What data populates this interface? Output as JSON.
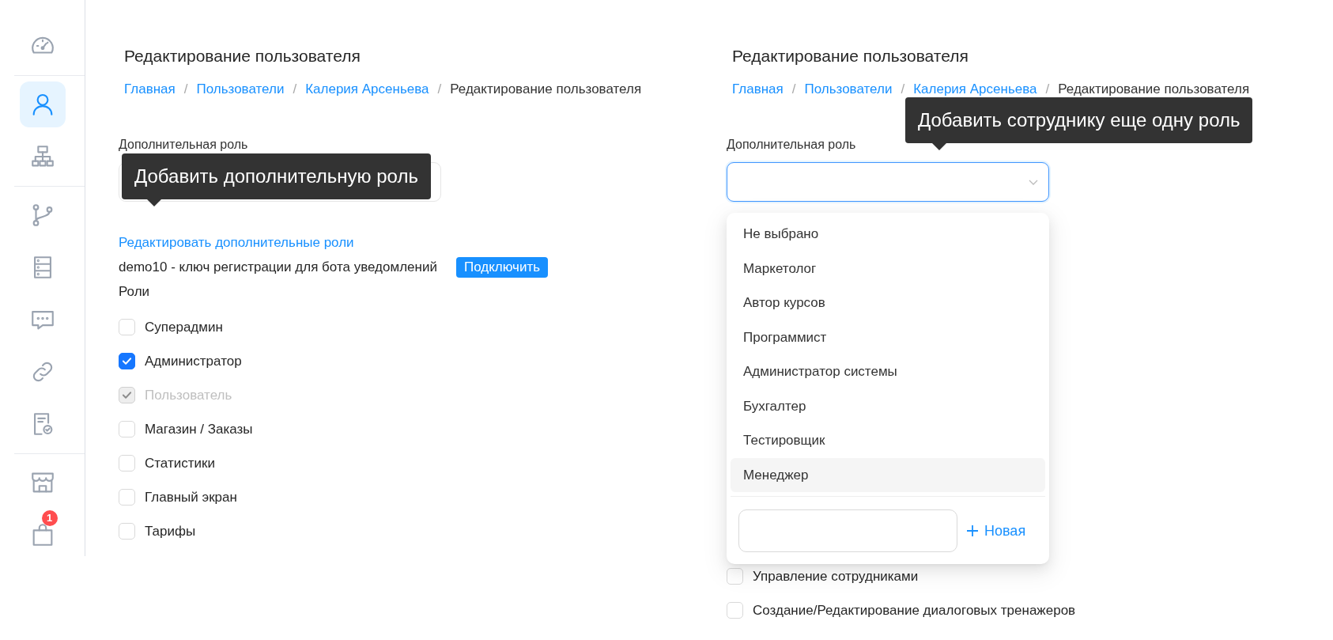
{
  "sidebar": {
    "groups": [
      {
        "items": [
          {
            "kind": "gauge",
            "selected": false
          }
        ]
      },
      {
        "items": [
          {
            "kind": "user",
            "selected": true
          },
          {
            "kind": "sitemap",
            "selected": false
          }
        ]
      },
      {
        "items": [
          {
            "kind": "branch",
            "selected": false
          },
          {
            "kind": "server",
            "selected": false
          },
          {
            "kind": "chat",
            "selected": false
          },
          {
            "kind": "link",
            "selected": false
          },
          {
            "kind": "document-check",
            "selected": false
          }
        ]
      },
      {
        "items": [
          {
            "kind": "store",
            "selected": false
          },
          {
            "kind": "bag",
            "selected": false,
            "badge": "1"
          }
        ]
      }
    ]
  },
  "panels": [
    {
      "title": "Редактирование пользователя",
      "breadcrumb_separator": "/",
      "breadcrumb": [
        {
          "label": "Главная",
          "link": true
        },
        {
          "label": "Пользователи",
          "link": true
        },
        {
          "label": "Калерия Арсеньева",
          "link": true
        },
        {
          "label": "Редактирование пользователя",
          "link": false
        }
      ],
      "extra_role": {
        "label": "Дополнительная роль",
        "expanded": false,
        "tooltip": "Добавить дополнительную роль"
      },
      "edit_link": "Редактировать дополнительные роли",
      "bot_key": {
        "text": "demo10 - ключ регистрации для бота уведомлений",
        "button": "Подключить"
      },
      "roles_heading": "Роли",
      "roles": [
        {
          "label": "Суперадмин",
          "checked": false,
          "disabled": false
        },
        {
          "label": "Администратор",
          "checked": true,
          "disabled": false
        },
        {
          "label": "Пользователь",
          "checked": true,
          "disabled": true
        },
        {
          "label": "Магазин / Заказы",
          "checked": false,
          "disabled": false
        },
        {
          "label": "Статистики",
          "checked": false,
          "disabled": false
        },
        {
          "label": "Главный экран",
          "checked": false,
          "disabled": false
        },
        {
          "label": "Тарифы",
          "checked": false,
          "disabled": false
        }
      ]
    },
    {
      "title": "Редактирование пользователя",
      "breadcrumb_separator": "/",
      "breadcrumb": [
        {
          "label": "Главная",
          "link": true
        },
        {
          "label": "Пользователи",
          "link": true
        },
        {
          "label": "Калерия Арсеньева",
          "link": true
        },
        {
          "label": "Редактирование пользователя",
          "link": false
        }
      ],
      "extra_role": {
        "label": "Дополнительная роль",
        "expanded": true,
        "tooltip": "Добавить сотруднику еще одну роль",
        "options": [
          {
            "label": "Не выбрано",
            "selected": false
          },
          {
            "label": "Маркетолог",
            "selected": false
          },
          {
            "label": "Автор курсов",
            "selected": false
          },
          {
            "label": "Программист",
            "selected": false
          },
          {
            "label": "Администратор системы",
            "selected": false
          },
          {
            "label": "Бухгалтер",
            "selected": false
          },
          {
            "label": "Тестировщик",
            "selected": false
          },
          {
            "label": "Менеджер",
            "selected": true
          }
        ],
        "new_button": "Новая"
      },
      "roles": [
        {
          "label": "Управление сотрудниками",
          "checked": false,
          "disabled": false
        },
        {
          "label": "Создание/Редактирование диалоговых тренажеров",
          "checked": false,
          "disabled": false
        }
      ]
    }
  ]
}
